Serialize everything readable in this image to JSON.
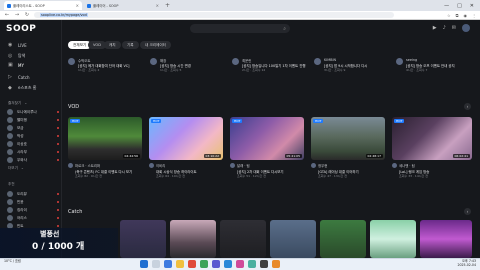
{
  "browser": {
    "tabs": [
      {
        "label": "플레이리스트 - SOOP",
        "active": true
      },
      {
        "label": "플레이어 - SOOP",
        "active": false
      }
    ],
    "url": "sooplive.co.kr/mypage/vod",
    "url_highlight": "sooplive.co.kr",
    "win_controls": [
      "—",
      "□",
      "✕"
    ]
  },
  "app": {
    "logo_text": "SOOP",
    "search_placeholder": "",
    "sidebar": {
      "nav": [
        {
          "label": "LIVE",
          "icon": "live-icon"
        },
        {
          "label": "탐색",
          "icon": "explore-icon"
        },
        {
          "label": "MY",
          "icon": "my-icon",
          "active": true
        },
        {
          "label": "Catch",
          "icon": "catch-icon"
        },
        {
          "label": "e스포츠 홈",
          "icon": "esports-icon"
        }
      ],
      "follow_header": "즐겨찾기",
      "follows": [
        "도나에이루나",
        "빨미펑",
        "보금",
        "박성",
        "이상호",
        "시라부",
        "우와사"
      ],
      "more_label": "더보기",
      "recommend_header": "추천",
      "recommends": [
        "도리뷰",
        "빈윤",
        "킹라이",
        "어리스",
        "빈트"
      ]
    },
    "chips": [
      "전체보기",
      "VOD",
      "캐치",
      "기록",
      "내 크리에이터"
    ],
    "posts": [
      {
        "name": "수박오트",
        "title": "[공지] 메가 대회참여 단어 대회 VC]",
        "meta": "1시간 · 조회수 2"
      },
      {
        "name": "해장",
        "title": "[공지] 방송 시간 변경",
        "meta": "1시간 · 조회수 5"
      },
      {
        "name": "최운린",
        "title": "[공지] 방송입니다 100일기 1차 이벤트 진행",
        "meta": "2시간 · 조회수 12"
      },
      {
        "name": "KIMBIN",
        "title": "[공지] 밤 9시 시작합니다 다시",
        "meta": "3시간 · 조회수 9"
      },
      {
        "name": "seeing",
        "title": "[공지] 방송 오프 이벤트 안내 공지",
        "meta": "4시간 · 조회수 7"
      }
    ],
    "vod_title": "VOD",
    "vods": [
      {
        "badge": "HOT",
        "name": "마르크 · 스트리머",
        "title": "(축구 콘텐츠) FC 대결 이벤트 다시 보기",
        "meta": "조회수 82 · 9시간 전",
        "dur": "04:44:56"
      },
      {
        "badge": "HOT",
        "name": "이비리",
        "title": "대회 시상식 방송 하이라이트",
        "meta": "조회수 64 · 10시간 전",
        "dur": "03:10:22"
      },
      {
        "badge": "HOT",
        "name": "달래 · 팀",
        "title": "[공지] 2차 대회 이벤트 다시보기",
        "meta": "조회수 51 · 12시간 전",
        "dur": "05:21:05"
      },
      {
        "badge": "HOT",
        "name": "정우현",
        "title": "[GTA] 레이싱 대결 이어하기",
        "meta": "조회수 47 · 13시간 전",
        "dur": "02:48:17"
      },
      {
        "badge": "HOT",
        "name": "세나맨 · 팀",
        "title": "[LoL] 랭크 게임 방송",
        "meta": "조회수 33 · 14시간 전",
        "dur": "06:02:41"
      }
    ],
    "catch_title": "Catch",
    "overlay_line1": "별풍선",
    "overlay_line2": "0 / 1000 개"
  },
  "taskbar": {
    "weather": "10°C / 흐림",
    "clock": "오후 7:43",
    "date": "2025-02-04"
  }
}
